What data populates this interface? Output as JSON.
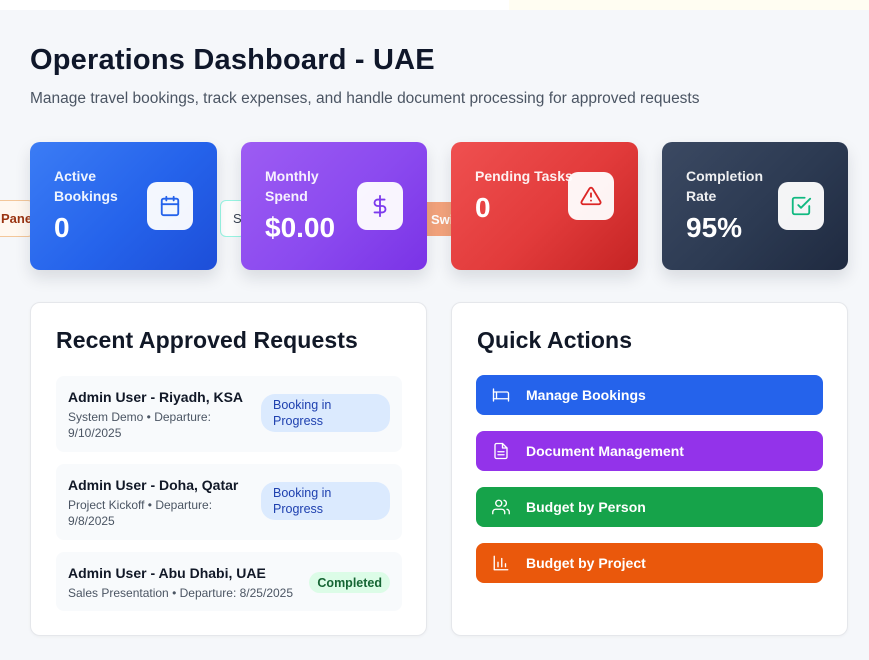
{
  "header": {
    "title": "Operations Dashboard - UAE",
    "subtitle": "Manage travel bookings, track expenses, and handle document processing for approved requests"
  },
  "peek_tabs": [
    "Pane",
    "S",
    "Swi"
  ],
  "stats": [
    {
      "label": "Active Bookings",
      "value": "0",
      "icon": "calendar-icon",
      "icon_color": "#2563eb"
    },
    {
      "label": "Monthly Spend",
      "value": "$0.00",
      "icon": "dollar-icon",
      "icon_color": "#7c3aed"
    },
    {
      "label": "Pending Tasks",
      "value": "0",
      "icon": "alert-triangle-icon",
      "icon_color": "#dc2626"
    },
    {
      "label": "Completion Rate",
      "value": "95%",
      "icon": "check-square-icon",
      "icon_color": "#10b981"
    }
  ],
  "recent": {
    "title": "Recent Approved Requests",
    "items": [
      {
        "name": "Admin User - Riyadh, KSA",
        "detail": "System Demo • Departure: 9/10/2025",
        "status": "Booking in Progress"
      },
      {
        "name": "Admin User - Doha, Qatar",
        "detail": "Project Kickoff • Departure: 9/8/2025",
        "status": "Booking in Progress"
      },
      {
        "name": "Admin User - Abu Dhabi, UAE",
        "detail": "Sales Presentation • Departure: 8/25/2025",
        "status": "Completed"
      }
    ]
  },
  "actions": {
    "title": "Quick Actions",
    "buttons": [
      {
        "label": "Manage Bookings",
        "icon": "bed-icon",
        "color": "#2563eb"
      },
      {
        "label": "Document Management",
        "icon": "document-icon",
        "color": "#9333ea"
      },
      {
        "label": "Budget by Person",
        "icon": "users-icon",
        "color": "#16a34a"
      },
      {
        "label": "Budget by Project",
        "icon": "bar-chart-icon",
        "color": "#ea580c"
      }
    ]
  }
}
